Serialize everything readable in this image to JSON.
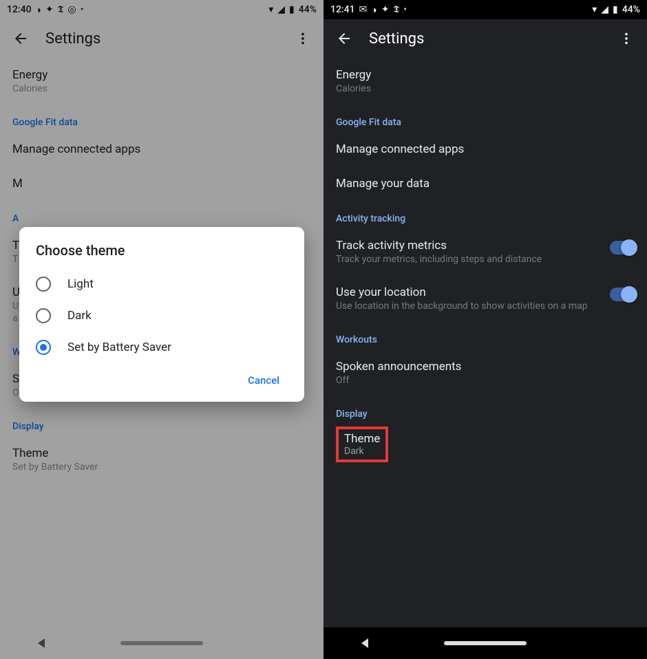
{
  "left": {
    "statusbar": {
      "time": "12:40",
      "battery": "44%"
    },
    "toolbar": {
      "title": "Settings"
    },
    "items": {
      "energy": {
        "title": "Energy",
        "sub": "Calories"
      },
      "section_fit": "Google Fit data",
      "manage_connected": {
        "title": "Manage connected apps"
      },
      "manage_data_initial": "M",
      "section_activity_initial": "A",
      "track_metrics_initial": "T",
      "track_metrics_sub_initial": "T",
      "use_location_initial": "U",
      "use_location_sub1": "U",
      "use_location_sub2": "a",
      "section_workouts": "Workouts",
      "spoken": {
        "title": "Spoken announcements",
        "sub": "Off"
      },
      "section_display": "Display",
      "theme": {
        "title": "Theme",
        "sub": "Set by Battery Saver"
      }
    },
    "dialog": {
      "title": "Choose theme",
      "options": {
        "light": "Light",
        "dark": "Dark",
        "battery": "Set by Battery Saver"
      },
      "cancel": "Cancel",
      "selected": "battery"
    }
  },
  "right": {
    "statusbar": {
      "time": "12:41",
      "battery": "44%"
    },
    "toolbar": {
      "title": "Settings"
    },
    "items": {
      "energy": {
        "title": "Energy",
        "sub": "Calories"
      },
      "section_fit": "Google Fit data",
      "manage_connected": {
        "title": "Manage connected apps"
      },
      "manage_data": {
        "title": "Manage your data"
      },
      "section_activity": "Activity tracking",
      "track_metrics": {
        "title": "Track activity metrics",
        "sub": "Track your metrics, including steps and distance"
      },
      "use_location": {
        "title": "Use your location",
        "sub": "Use location in the background to show activities on a map"
      },
      "section_workouts": "Workouts",
      "spoken": {
        "title": "Spoken announcements",
        "sub": "Off"
      },
      "section_display": "Display",
      "theme": {
        "title": "Theme",
        "sub": "Dark"
      }
    }
  }
}
